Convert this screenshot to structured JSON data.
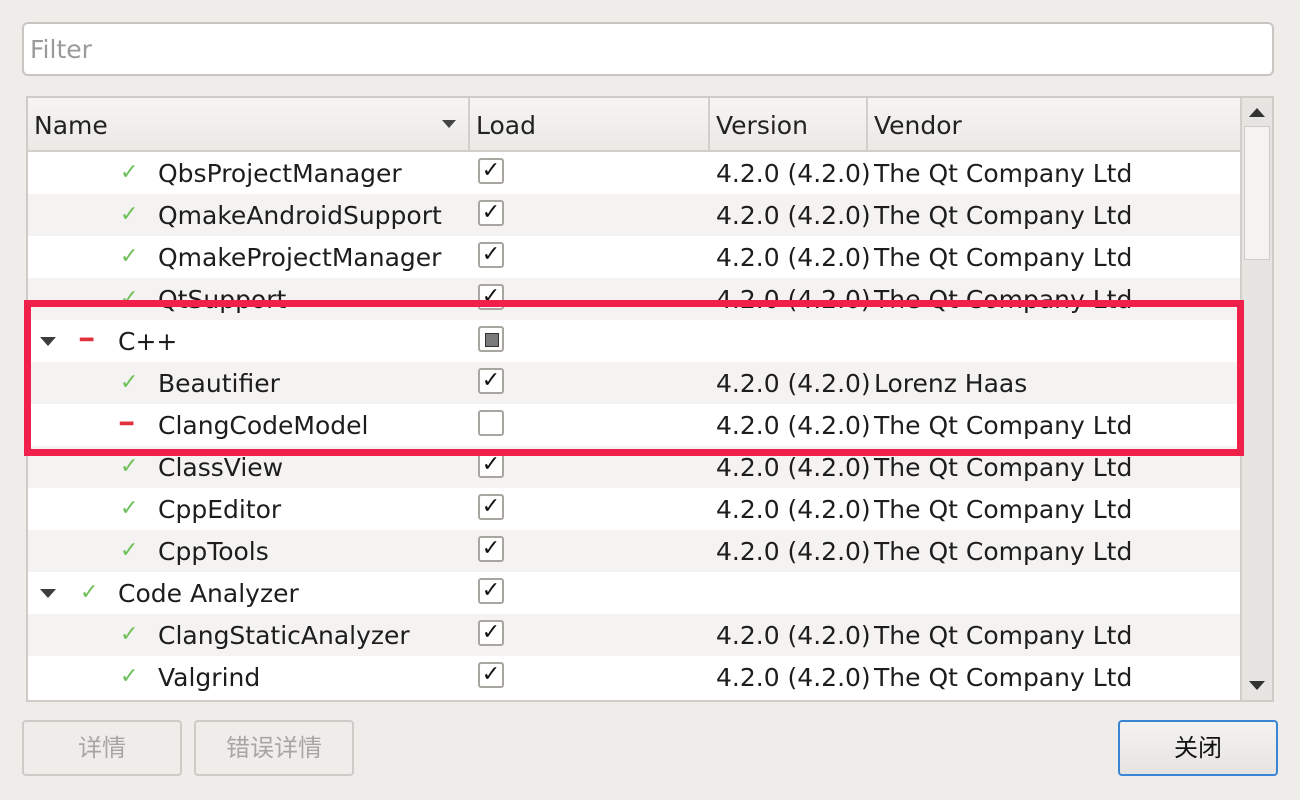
{
  "filter": {
    "placeholder": "Filter",
    "value": ""
  },
  "columns": {
    "name": "Name",
    "load": "Load",
    "version": "Version",
    "vendor": "Vendor"
  },
  "rows": [
    {
      "type": "plugin",
      "status": "ok",
      "name": "QbsProjectManager",
      "load": "checked",
      "version": "4.2.0 (4.2.0)",
      "vendor": "The Qt Company Ltd"
    },
    {
      "type": "plugin",
      "status": "ok",
      "name": "QmakeAndroidSupport",
      "load": "checked",
      "version": "4.2.0 (4.2.0)",
      "vendor": "The Qt Company Ltd"
    },
    {
      "type": "plugin",
      "status": "ok",
      "name": "QmakeProjectManager",
      "load": "checked",
      "version": "4.2.0 (4.2.0)",
      "vendor": "The Qt Company Ltd"
    },
    {
      "type": "plugin",
      "status": "ok",
      "name": "QtSupport",
      "load": "checked",
      "version": "4.2.0 (4.2.0)",
      "vendor": "The Qt Company Ltd"
    },
    {
      "type": "group",
      "status": "off",
      "name": "C++",
      "load": "partial",
      "version": "",
      "vendor": ""
    },
    {
      "type": "plugin",
      "status": "ok",
      "name": "Beautifier",
      "load": "checked",
      "version": "4.2.0 (4.2.0)",
      "vendor": "Lorenz Haas"
    },
    {
      "type": "plugin",
      "status": "off",
      "name": "ClangCodeModel",
      "load": "unchecked",
      "version": "4.2.0 (4.2.0)",
      "vendor": "The Qt Company Ltd"
    },
    {
      "type": "plugin",
      "status": "ok",
      "name": "ClassView",
      "load": "checked",
      "version": "4.2.0 (4.2.0)",
      "vendor": "The Qt Company Ltd"
    },
    {
      "type": "plugin",
      "status": "ok",
      "name": "CppEditor",
      "load": "checked",
      "version": "4.2.0 (4.2.0)",
      "vendor": "The Qt Company Ltd"
    },
    {
      "type": "plugin",
      "status": "ok",
      "name": "CppTools",
      "load": "checked",
      "version": "4.2.0 (4.2.0)",
      "vendor": "The Qt Company Ltd"
    },
    {
      "type": "group",
      "status": "ok",
      "name": "Code Analyzer",
      "load": "checked",
      "version": "",
      "vendor": ""
    },
    {
      "type": "plugin",
      "status": "ok",
      "name": "ClangStaticAnalyzer",
      "load": "checked",
      "version": "4.2.0 (4.2.0)",
      "vendor": "The Qt Company Ltd"
    },
    {
      "type": "plugin",
      "status": "ok",
      "name": "Valgrind",
      "load": "checked",
      "version": "4.2.0 (4.2.0)",
      "vendor": "The Qt Company Ltd"
    }
  ],
  "buttons": {
    "details": "详情",
    "error_details": "错误详情",
    "close": "关闭"
  },
  "colors": {
    "ok": "#6fbf5a",
    "off": "#e0303c",
    "highlight": "#f0204a",
    "focus": "#3b86d4"
  },
  "icons": {
    "ok": "check-icon",
    "off": "dash-icon",
    "expander": "triangle-down-icon"
  }
}
